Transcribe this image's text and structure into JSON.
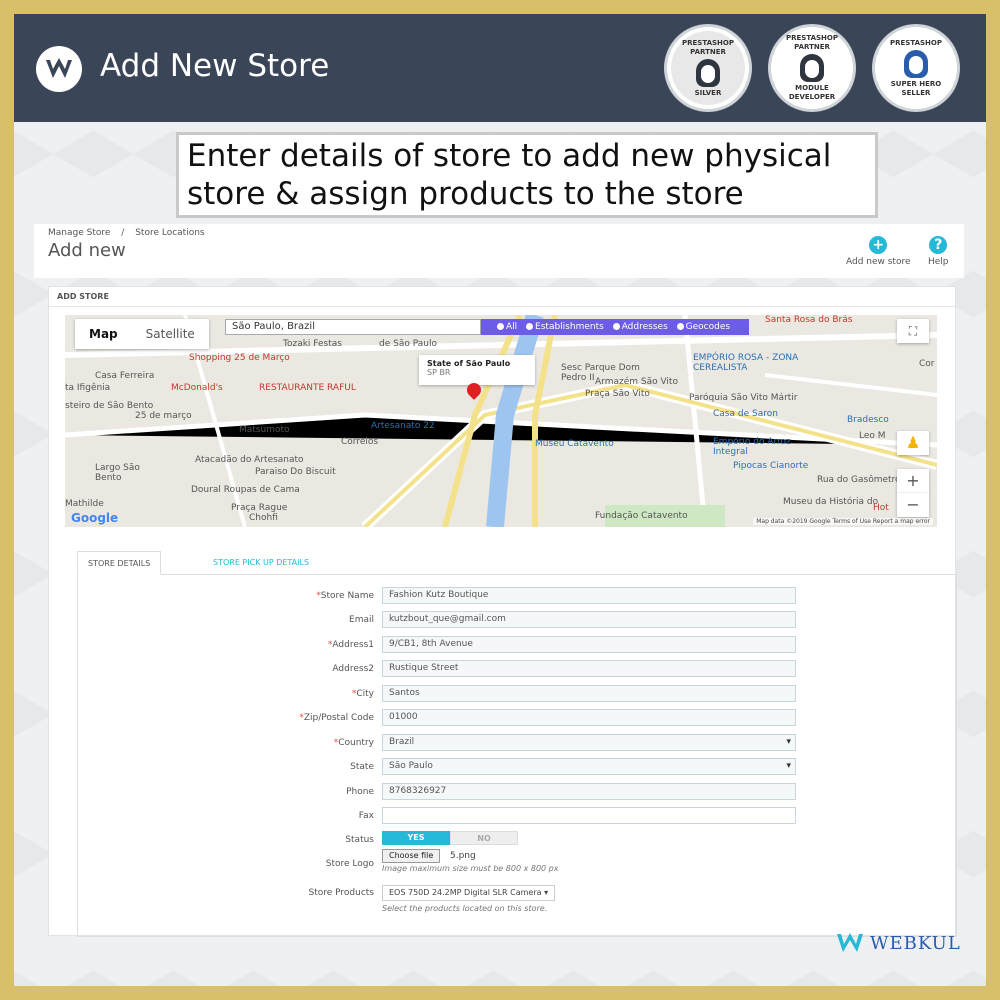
{
  "header": {
    "title": "Add New Store",
    "badges": [
      {
        "top": "PRESTASHOP PARTNER",
        "bottom": "SILVER"
      },
      {
        "top": "PRESTASHOP PARTNER",
        "bottom": "MODULE DEVELOPER"
      },
      {
        "top": "PRESTASHOP",
        "bottom": "SUPER HERO SELLER"
      }
    ]
  },
  "caption": "Enter details of store to add new physical store & assign products to the store",
  "admin": {
    "breadcrumb": [
      "Manage Store",
      "/",
      "Store Locations"
    ],
    "page_title": "Add new",
    "add_store_label": "Add new store",
    "help_label": "Help",
    "card_title": "ADD STORE"
  },
  "map": {
    "view_map": "Map",
    "view_satellite": "Satellite",
    "search_value": "São Paulo, Brazil",
    "filters": [
      "All",
      "Establishments",
      "Addresses",
      "Geocodes"
    ],
    "popup_title": "State of São Paulo",
    "popup_sub": "SP BR",
    "google": "Google",
    "credit": "Map data ©2019 Google   Terms of Use   Report a map error",
    "labels": [
      "Tozaki Festas",
      "de São Paulo",
      "Shopping 25 de Março",
      "Casa Ferreira",
      "ta Ifigênia",
      "McDonald's",
      "RESTAURANTE RAFUL",
      "steiro de São Bento",
      "25 de março",
      "Matsumoto",
      "Artesanato 22",
      "Correios",
      "Atacadão do Artesanato",
      "Largo São Bento",
      "Paraiso Do Biscuit",
      "Doural Roupas de Cama",
      "Mathilde",
      "Praça Rague",
      "Chohfi",
      "Sesc Parque Dom Pedro II",
      "Armazém São Vito",
      "Praça São Vito",
      "Museu Catavento",
      "Fundação Catavento",
      "EMPÓRIO ROSA - ZONA CEREALISTA",
      "Paróquia São Vito Mártir",
      "Casa de Saron",
      "Bradesco",
      "Empório do Arroz Integral",
      "Pipocas Cianorte",
      "Rua do Gasômetro",
      "Museu da História do",
      "Santa Rosa do Brás",
      "Leo M",
      "Cor",
      "Hot"
    ]
  },
  "tabs": {
    "details": "STORE DETAILS",
    "pickup": "STORE PICK UP DETAILS"
  },
  "form": {
    "store_name": {
      "label": "Store Name",
      "value": "Fashion Kutz Boutique"
    },
    "email": {
      "label": "Email",
      "value": "kutzbout_que@gmail.com"
    },
    "address1": {
      "label": "Address1",
      "value": "9/CB1, 8th Avenue"
    },
    "address2": {
      "label": "Address2",
      "value": "Rustique Street"
    },
    "city": {
      "label": "City",
      "value": "Santos"
    },
    "zip": {
      "label": "Zip/Postal Code",
      "value": "01000"
    },
    "country": {
      "label": "Country",
      "value": "Brazil"
    },
    "state": {
      "label": "State",
      "value": "São Paulo"
    },
    "phone": {
      "label": "Phone",
      "value": "8768326927"
    },
    "fax": {
      "label": "Fax",
      "value": ""
    },
    "status": {
      "label": "Status",
      "yes": "YES",
      "no": "NO"
    },
    "logo": {
      "label": "Store Logo",
      "button": "Choose file",
      "filename": "5.png",
      "hint": "Image maximum size must be 800 x 800 px"
    },
    "products": {
      "label": "Store Products",
      "value": "EOS 750D 24.2MP Digital SLR Camera",
      "hint": "Select the products located on this store."
    }
  },
  "footer_brand": "WEBKUL"
}
